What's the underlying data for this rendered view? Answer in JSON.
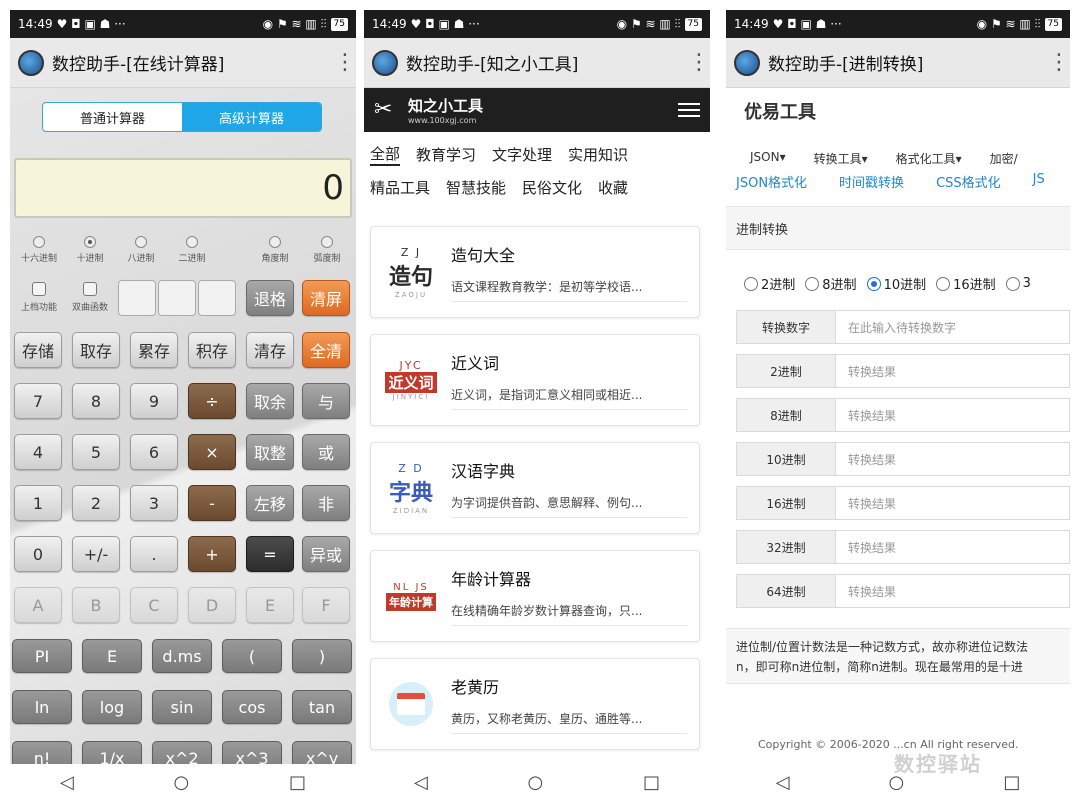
{
  "status": {
    "time": "14:49",
    "battery": "75"
  },
  "calculator": {
    "app_title": "数控助手-[在线计算器]",
    "mode_tabs": [
      "普通计算器",
      "高级计算器"
    ],
    "display": "0",
    "radios": [
      "十六进制",
      "十进制",
      "八进制",
      "二进制",
      "角度制",
      "弧度制"
    ],
    "checks": [
      "上档功能",
      "双曲函数"
    ],
    "keys": [
      [
        "退格",
        "清屏"
      ],
      [
        "存储",
        "取存",
        "累存",
        "积存",
        "清存",
        "全清"
      ],
      [
        "7",
        "8",
        "9",
        "÷",
        "取余",
        "与"
      ],
      [
        "4",
        "5",
        "6",
        "×",
        "取整",
        "或"
      ],
      [
        "1",
        "2",
        "3",
        "-",
        "左移",
        "非"
      ],
      [
        "0",
        "+/-",
        ".",
        "+",
        "=",
        "异或"
      ],
      [
        "A",
        "B",
        "C",
        "D",
        "E",
        "F"
      ],
      [
        "PI",
        "E",
        "d.ms",
        "(",
        ")"
      ],
      [
        "ln",
        "log",
        "sin",
        "cos",
        "tan"
      ],
      [
        "n!",
        "1/x",
        "x^2",
        "x^3",
        "x^y"
      ]
    ]
  },
  "tools": {
    "app_title": "数控助手-[知之小工具]",
    "site_name": "知之小工具",
    "site_url": "www.100xgj.com",
    "categories_row1": [
      "全部",
      "教育学习",
      "文字处理",
      "实用知识"
    ],
    "categories_row2": [
      "精品工具",
      "智慧技能",
      "民俗文化",
      "收藏"
    ],
    "cards": [
      {
        "name": "造句大全",
        "desc": "语文课程教育教学：是初等学校语...",
        "thumb": "造句",
        "thumb_top": "Z J",
        "thumb_sub": "ZAOJU",
        "color": "#2a2a2a"
      },
      {
        "name": "近义词",
        "desc": "近义词，是指词汇意义相同或相近...",
        "thumb": "近义词",
        "thumb_top": "JYC",
        "thumb_sub": "JINYICI",
        "color": "#c0392b"
      },
      {
        "name": "汉语字典",
        "desc": "为字词提供音韵、意思解释、例句...",
        "thumb": "字典",
        "thumb_top": "Z D",
        "thumb_sub": "ZIDIAN",
        "color": "#3b5bb8"
      },
      {
        "name": "年龄计算器",
        "desc": "在线精确年龄岁数计算器查询，只...",
        "thumb": "年龄计算",
        "thumb_top": "NL JS",
        "thumb_sub": "",
        "color": "#c0392b"
      },
      {
        "name": "老黄历",
        "desc": "黄历，又称老黄历、皇历、通胜等...",
        "thumb": "",
        "thumb_top": "",
        "thumb_sub": "",
        "color": "#e74c3c"
      }
    ]
  },
  "converter": {
    "app_title": "数控助手-[进制转换]",
    "brand": "优易工具",
    "menu": [
      "JSON▾",
      "转换工具▾",
      "格式化工具▾",
      "加密/"
    ],
    "sublinks": [
      "JSON格式化",
      "时间戳转换",
      "CSS格式化",
      "JS"
    ],
    "section_title": "进制转换",
    "bases": [
      "2进制",
      "8进制",
      "10进制",
      "16进制",
      "3"
    ],
    "input_label": "转换数字",
    "input_placeholder": "在此输入待转换数字",
    "rows": [
      {
        "label": "2进制",
        "value": "转换结果"
      },
      {
        "label": "8进制",
        "value": "转换结果"
      },
      {
        "label": "10进制",
        "value": "转换结果"
      },
      {
        "label": "16进制",
        "value": "转换结果"
      },
      {
        "label": "32进制",
        "value": "转换结果"
      },
      {
        "label": "64进制",
        "value": "转换结果"
      }
    ],
    "description_1": "进位制/位置计数法是一种记数方式，故亦称进位记数法",
    "description_2": "n，即可称n进位制，简称n进制。现在最常用的是十进",
    "footer": "Copyright © 2006-2020 ...cn All right reserved."
  },
  "watermark": "数控驿站"
}
